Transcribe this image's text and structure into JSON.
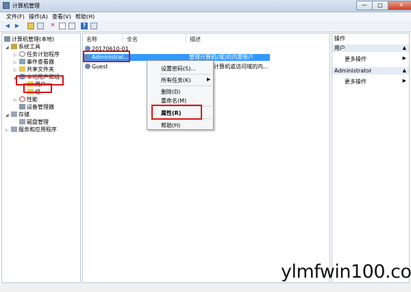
{
  "window": {
    "title": "计算机管理"
  },
  "titlebar": {
    "minimize": "—",
    "maximize": "□",
    "close": "✕"
  },
  "menu": [
    "文件(F)",
    "操作(A)",
    "查看(V)",
    "帮助(H)"
  ],
  "tree": {
    "root": "计算机管理(本地)",
    "system_tools": "系统工具",
    "task_scheduler": "任务计划程序",
    "event_viewer": "事件查看器",
    "shared_folders": "共享文件夹",
    "local_users_groups": "本地用户和组",
    "users": "用户",
    "groups": "组",
    "performance": "性能",
    "device_manager": "设备管理器",
    "storage": "存储",
    "disk_management": "磁盘管理",
    "services_apps": "服务和应用程序"
  },
  "list": {
    "columns": [
      "名称",
      "全名",
      "描述"
    ],
    "rows": [
      {
        "name": "20170610-01",
        "fullname": "",
        "desc": ""
      },
      {
        "name": "Administrat...",
        "fullname": "",
        "desc": "管理计算机(域)的内置帐户"
      },
      {
        "name": "Guest",
        "fullname": "",
        "desc": "计算机或访问域的内..."
      }
    ]
  },
  "context_menu": {
    "set_password": "设置密码(S)...",
    "all_tasks": "所有任务(K)",
    "delete": "删除(D)",
    "rename": "重命名(M)",
    "properties": "属性(R)",
    "help": "帮助(H)"
  },
  "actions_pane": {
    "header": "操作",
    "section1": "用户",
    "more1": "更多操作",
    "section2": "Administrator",
    "more2": "更多操作"
  },
  "watermark": "ylmfwin100.com",
  "colors": {
    "highlight": "#3399ff",
    "annotation": "#dd1111",
    "title_bar": "#c4d3e6"
  }
}
